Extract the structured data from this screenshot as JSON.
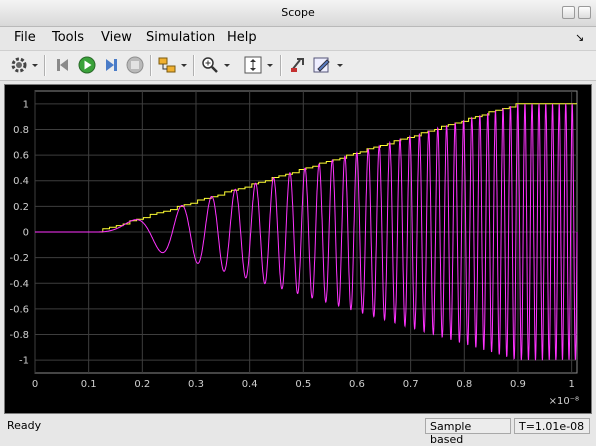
{
  "window": {
    "title": "Scope"
  },
  "menu": {
    "items": [
      "File",
      "Tools",
      "View",
      "Simulation",
      "Help"
    ]
  },
  "toolbar": {
    "icons": [
      "gear-icon",
      "step-back-icon",
      "run-icon",
      "step-forward-icon",
      "stop-icon",
      "signal-select-icon",
      "zoom-icon",
      "autoscale-icon",
      "highlight-block-icon",
      "edit-icon"
    ]
  },
  "chart_data": {
    "type": "line",
    "background": "#000000",
    "grid": true,
    "xlim": [
      0,
      1.01
    ],
    "ylim": [
      -1.1,
      1.1
    ],
    "x_scale_label": "×10⁻⁸",
    "x_ticks": [
      "0",
      "0.1",
      "0.2",
      "0.3",
      "0.4",
      "0.5",
      "0.6",
      "0.7",
      "0.8",
      "0.9",
      "1"
    ],
    "y_ticks": [
      "1",
      "0.8",
      "0.6",
      "0.4",
      "0.2",
      "0",
      "-0.2",
      "-0.4",
      "-0.6",
      "-0.8",
      "-1"
    ],
    "series": [
      {
        "color": "#ffff33",
        "x": [
          0,
          0.11,
          0.9,
          1.01
        ],
        "y": [
          0,
          0,
          1,
          1
        ]
      },
      {
        "color": "#ff33ff",
        "x": [
          0,
          0.11,
          0.9,
          1.01
        ],
        "y": [
          0,
          0,
          1,
          1
        ],
        "oscillation_start": 0.11,
        "oscillation_periods_to_end": 38
      }
    ]
  },
  "status": {
    "ready": "Ready",
    "mode": "Sample based",
    "time": "T=1.01e-08"
  }
}
